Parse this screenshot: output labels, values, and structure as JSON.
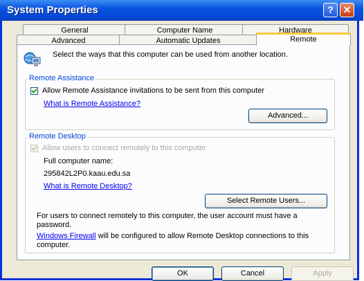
{
  "window": {
    "title": "System Properties",
    "help_glyph": "?",
    "close_glyph": "✕"
  },
  "tabs": {
    "row1": [
      "General",
      "Computer Name",
      "Hardware"
    ],
    "row2": [
      "Advanced",
      "Automatic Updates",
      "Remote"
    ],
    "active": "Remote"
  },
  "intro": {
    "text": "Select the ways that this computer can be used from another location."
  },
  "remote_assistance": {
    "label": "Remote Assistance",
    "checkbox_label": "Allow Remote Assistance invitations to be sent from this computer",
    "checked": true,
    "link": "What is Remote Assistance?",
    "advanced_button": "Advanced..."
  },
  "remote_desktop": {
    "label": "Remote Desktop",
    "checkbox_label": "Allow users to connect remotely to this computer",
    "checked": true,
    "enabled": false,
    "full_name_label": "Full computer name:",
    "full_name_value": "295842L2P0.kaau.edu.sa",
    "link": "What is Remote Desktop?",
    "select_users_button": "Select Remote Users...",
    "note": "For users to connect remotely to this computer, the user account must have a password.",
    "firewall_link": "Windows Firewall",
    "firewall_text": " will be configured to allow Remote Desktop connections to this computer."
  },
  "footer": {
    "ok": "OK",
    "cancel": "Cancel",
    "apply": "Apply"
  },
  "colors": {
    "titlebar": "#0a55e0",
    "group_label": "#0046d5",
    "link": "#0000ee",
    "tab_highlight": "#ffc83c"
  }
}
